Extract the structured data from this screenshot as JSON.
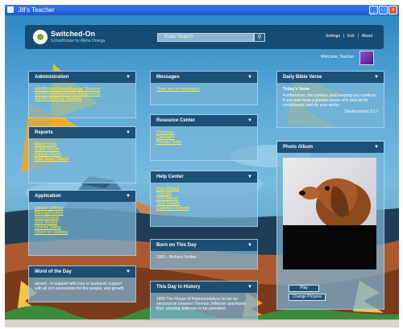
{
  "window": {
    "title": "Jill's Teacher"
  },
  "header": {
    "logo_name": "Switched-On",
    "logo_sub": "Schoolhouse by Alpha Omega",
    "search_placeholder": "Enter Search",
    "links": [
      "Settings",
      "Exit",
      "About"
    ],
    "welcome": "Welcome, Teacher"
  },
  "panels": {
    "administration": {
      "title": "Administration",
      "links": [
        "Add/Modify/Delete/Manage Students",
        "Add/Modify/Delete/AOL Assignments",
        "Add/Modify/Drop Students"
      ]
    },
    "reports": {
      "title": "Reports",
      "links": [
        "Report Card",
        "Grade Report",
        "Subject Report",
        "Data Graph Report"
      ]
    },
    "application": {
      "title": "Application",
      "links": [
        "Update Settings",
        "Backup/Restore",
        "Import/Export",
        "Sync Wizard",
        "License Status",
        "Check for Updates"
      ]
    },
    "word_of_day": {
      "title": "Word of the Day",
      "text": "assent - to support with love or husband; support with all of it association for the people, and growth"
    },
    "messages": {
      "title": "Messages",
      "links": [
        "There are no messages."
      ]
    },
    "resource_center": {
      "title": "Resource Center",
      "links": [
        "Dictionary",
        "Calculator",
        "Periodic Table"
      ]
    },
    "help_center": {
      "title": "Help Center",
      "links": [
        "Help Manual",
        "Tutorials",
        "SOS Basics",
        "Tech Support",
        "Customer Support"
      ]
    },
    "born_on_day": {
      "title": "Born on This Day",
      "text": "1901 - Richard Jordan"
    },
    "history": {
      "title": "This Day in History",
      "text": "1800 The House of Representatives broke an electoral tie between Thomas Jefferson and Aaron Burr, electing Jefferson to be president."
    },
    "bible_verse": {
      "title": "Daily Bible Verse",
      "verse_title": "Today's Verse",
      "text": "Furthermore, the sunless, and keeping you continue, if you now have a greater peace of it, and as for unrighteous, and do your works.",
      "reference": "Deuteronomy 3:17"
    },
    "photo_album": {
      "title": "Photo Album",
      "play": "Play",
      "change": "Change Pictures"
    }
  },
  "statusbar": {
    "text": ""
  },
  "colors": {
    "panel_header": "#164b70",
    "link": "#ffeb3b",
    "title_bar": "#2a69d8"
  }
}
